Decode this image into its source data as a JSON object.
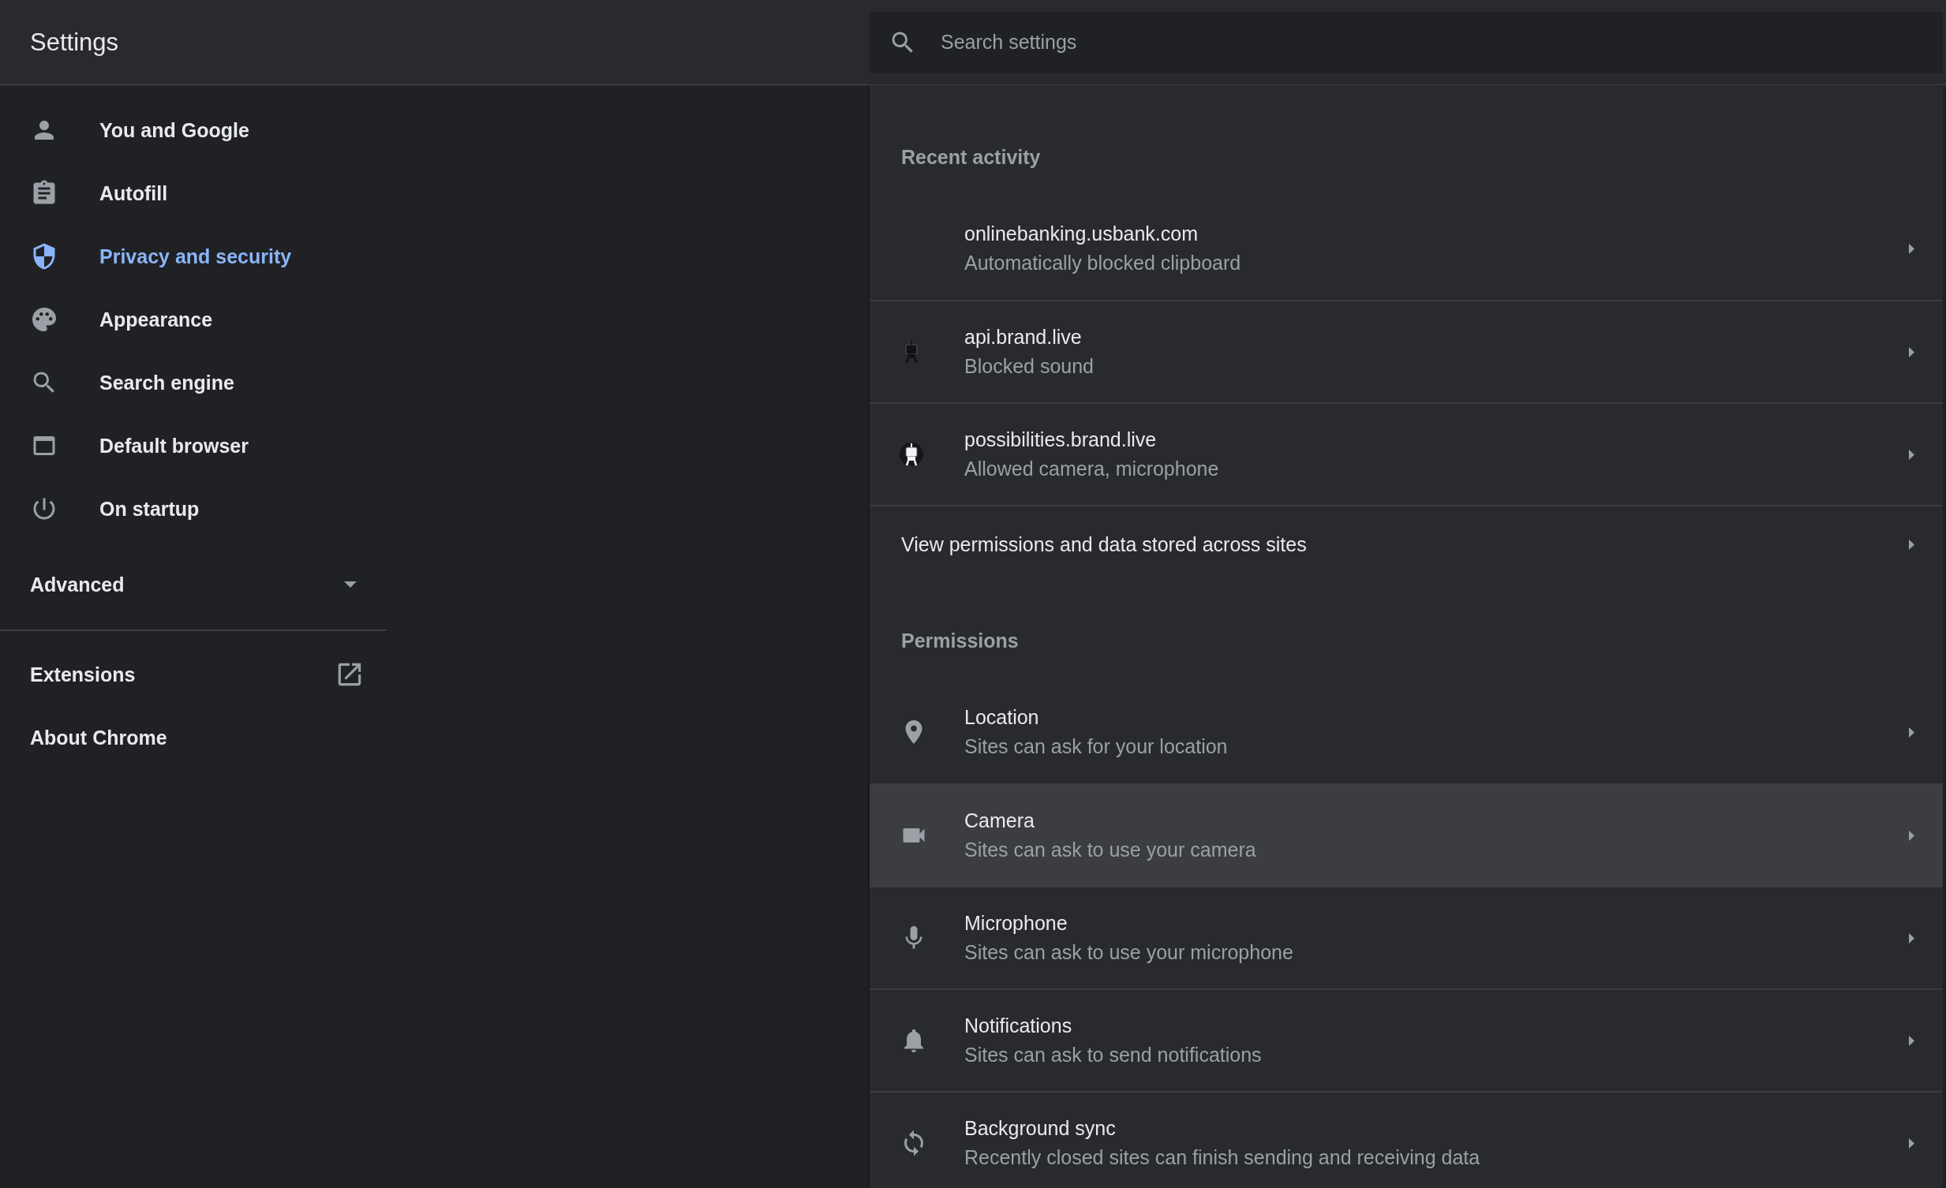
{
  "header": {
    "title": "Settings",
    "search": {
      "placeholder": "Search settings"
    }
  },
  "sidebar": {
    "items": [
      {
        "label": "You and Google",
        "selected": false
      },
      {
        "label": "Autofill",
        "selected": false
      },
      {
        "label": "Privacy and security",
        "selected": true
      },
      {
        "label": "Appearance",
        "selected": false
      },
      {
        "label": "Search engine",
        "selected": false
      },
      {
        "label": "Default browser",
        "selected": false
      },
      {
        "label": "On startup",
        "selected": false
      }
    ],
    "advanced": {
      "label": "Advanced",
      "expanded": false
    },
    "links": [
      {
        "label": "Extensions",
        "external": true
      },
      {
        "label": "About Chrome",
        "external": false
      }
    ]
  },
  "recent_activity": {
    "heading": "Recent activity",
    "sites": [
      {
        "title": "onlinebanking.usbank.com",
        "subtitle": "Automatically blocked clipboard",
        "kind": "blank"
      },
      {
        "title": "api.brand.live",
        "subtitle": "Blocked sound",
        "kind": "dark"
      },
      {
        "title": "possibilities.brand.live",
        "subtitle": "Allowed camera, microphone",
        "kind": "light"
      }
    ],
    "view_all": "View permissions and data stored across sites"
  },
  "permissions": {
    "heading": "Permissions",
    "items": [
      {
        "title": "Location",
        "subtitle": "Sites can ask for your location",
        "selected": false
      },
      {
        "title": "Camera",
        "subtitle": "Sites can ask to use your camera",
        "selected": true
      },
      {
        "title": "Microphone",
        "subtitle": "Sites can ask to use your microphone",
        "selected": false
      },
      {
        "title": "Notifications",
        "subtitle": "Sites can ask to send notifications",
        "selected": false
      },
      {
        "title": "Background sync",
        "subtitle": "Recently closed sites can finish sending and receiving data",
        "selected": false
      }
    ]
  }
}
